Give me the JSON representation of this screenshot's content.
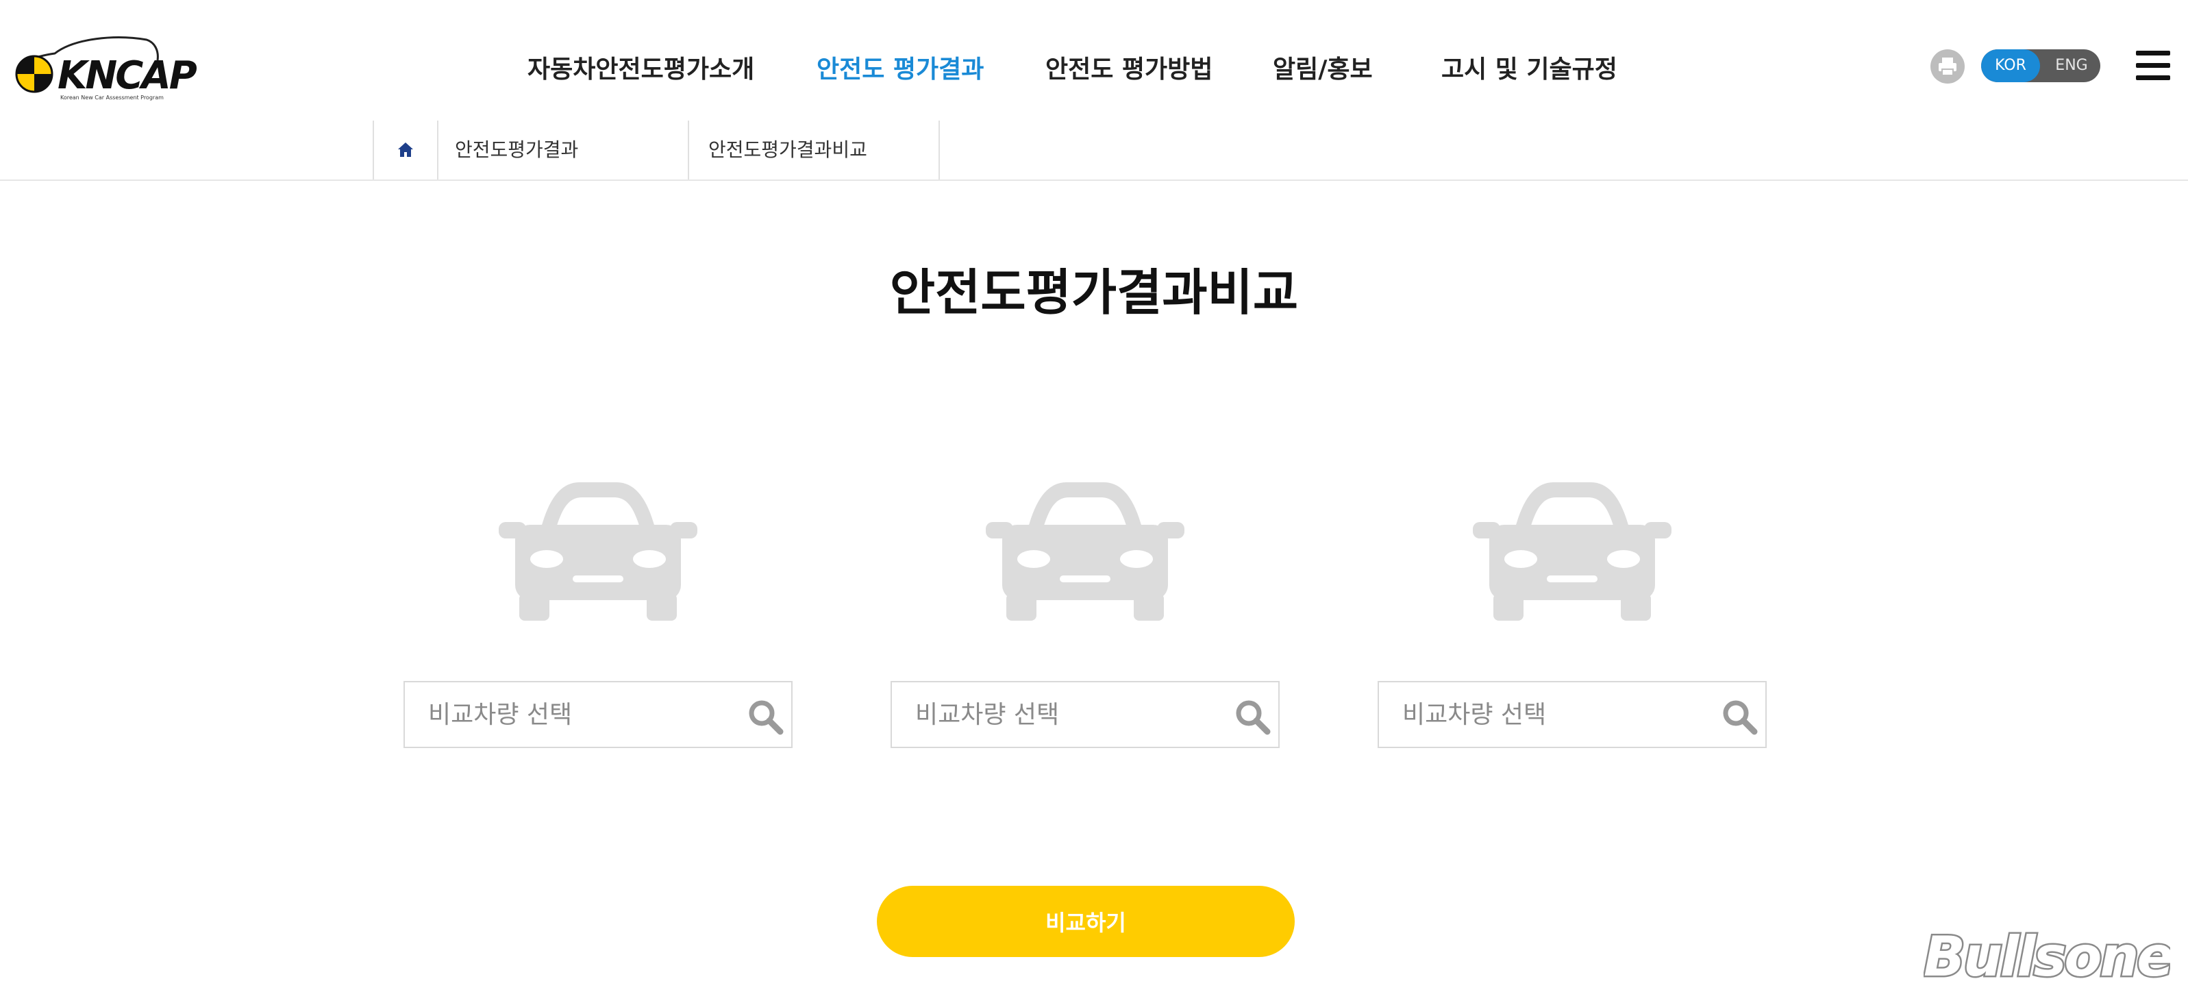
{
  "header": {
    "logo_text": "KNCAP",
    "logo_subtitle": "Korean New Car Assessment Program",
    "nav": [
      {
        "label": "자동차안전도평가소개",
        "active": false
      },
      {
        "label": "안전도 평가결과",
        "active": true
      },
      {
        "label": "안전도 평가방법",
        "active": false
      },
      {
        "label": "알림/홍보",
        "active": false
      },
      {
        "label": "고시 및 기술규정",
        "active": false
      }
    ],
    "lang": {
      "kor": "KOR",
      "eng": "ENG",
      "selected": "KOR"
    },
    "icons": {
      "print": "print-icon",
      "menu": "hamburger-menu-icon"
    }
  },
  "breadcrumb": {
    "home_icon": "home-icon",
    "items": [
      "안전도평가결과",
      "안전도평가결과비교"
    ]
  },
  "page": {
    "title": "안전도평가결과비교",
    "slots": [
      {
        "icon": "car-icon",
        "placeholder": "비교차량 선택",
        "value": ""
      },
      {
        "icon": "car-icon",
        "placeholder": "비교차량 선택",
        "value": ""
      },
      {
        "icon": "car-icon",
        "placeholder": "비교차량 선택",
        "value": ""
      }
    ],
    "compare_button": "비교하기"
  },
  "watermark": "Bullsone",
  "colors": {
    "accent_blue": "#1a8ad6",
    "button_yellow": "#ffcc00",
    "car_gray": "#dcdcdc",
    "icon_gray": "#9a9a9a"
  }
}
